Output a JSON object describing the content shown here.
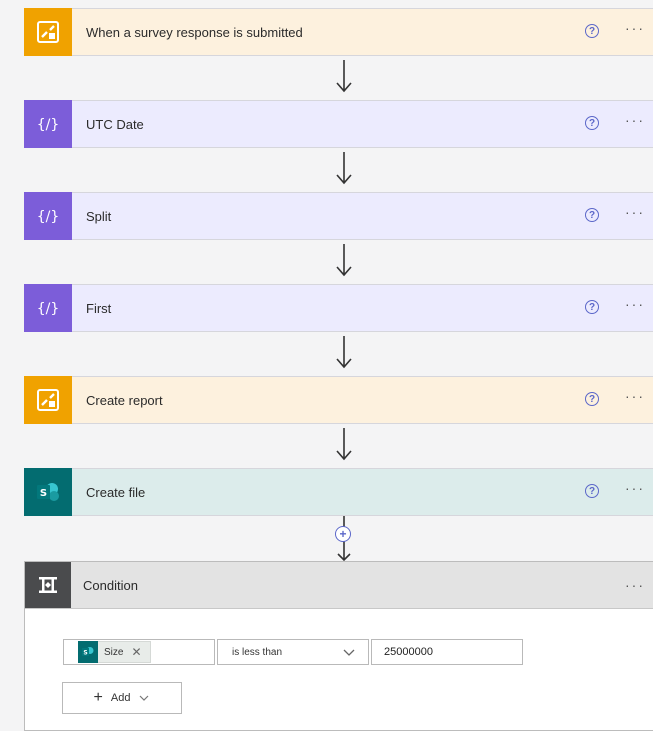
{
  "flow": {
    "steps": [
      {
        "title": "When a survey response is submitted",
        "kind": "forms",
        "icon": "forms-icon"
      },
      {
        "title": "UTC Date",
        "kind": "expression",
        "icon": "expression-icon"
      },
      {
        "title": "Split",
        "kind": "expression",
        "icon": "expression-icon"
      },
      {
        "title": "First",
        "kind": "expression",
        "icon": "expression-icon"
      },
      {
        "title": "Create report",
        "kind": "forms",
        "icon": "forms-icon"
      },
      {
        "title": "Create file",
        "kind": "sharepoint",
        "icon": "sharepoint-icon"
      }
    ],
    "help_symbol": "?",
    "more_symbol": "···",
    "insert_symbol": "+"
  },
  "condition": {
    "title": "Condition",
    "more_symbol": "···",
    "row": {
      "token_label": "Size",
      "token_remove_symbol": "✕",
      "operator": "is less than",
      "value": "25000000"
    },
    "add_label": "Add",
    "add_symbol": "+"
  },
  "colors": {
    "forms": "#f0a200",
    "expression": "#7c5dd9",
    "sharepoint": "#036c70",
    "condition": "#4a4b4d",
    "accent": "#5b67c9"
  }
}
